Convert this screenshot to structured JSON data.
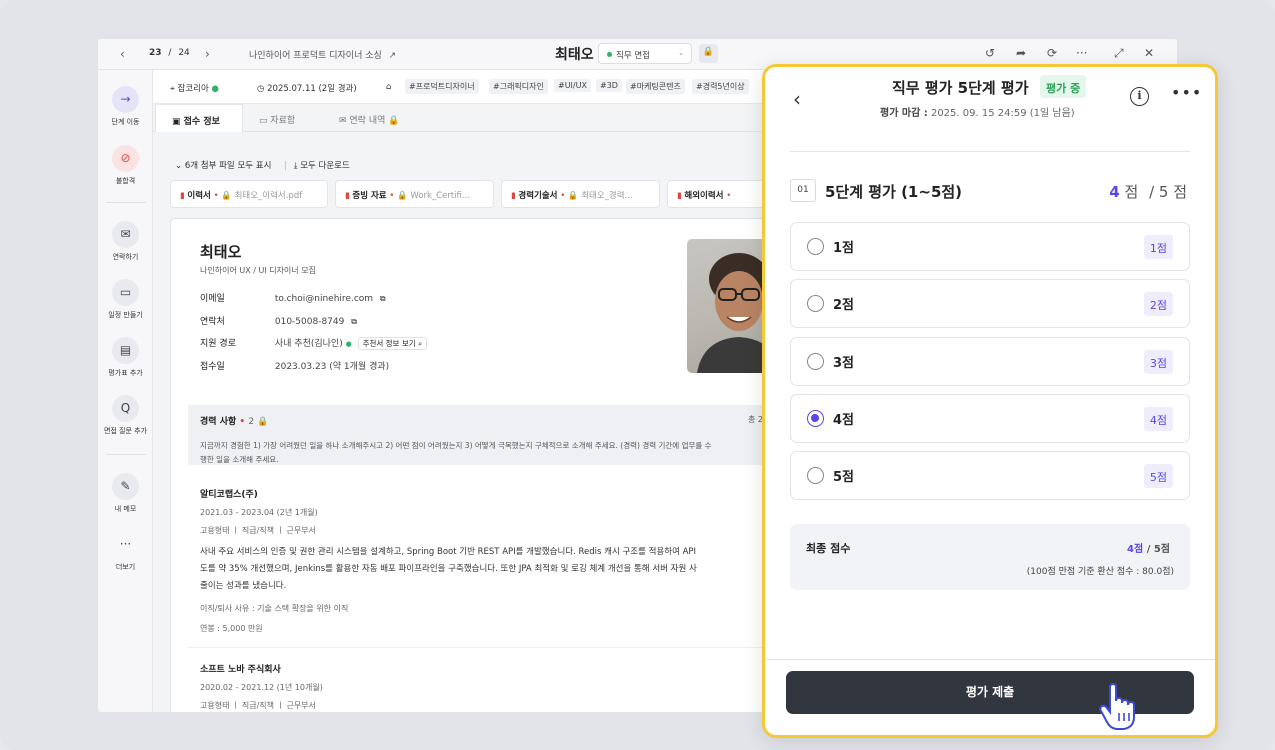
{
  "topbar": {
    "prev_icon": "chevron-left-icon",
    "next_icon": "chevron-right-icon",
    "page_current": "23",
    "page_sep": "/",
    "page_total": "24",
    "breadcrumb": "나인하이어 프로덕트 디자이너 소싱",
    "candidate_name": "최태오",
    "stage": "직무 면접",
    "stage_color": "#2fb36b"
  },
  "leftnav": {
    "items": [
      {
        "label": "단계 이동",
        "icon": "arrow-right-icon"
      },
      {
        "label": "불합격",
        "icon": "block-icon"
      },
      {
        "label": "연락하기",
        "icon": "mail-icon"
      },
      {
        "label": "일정 만들기",
        "icon": "calendar-icon"
      },
      {
        "label": "평가표 추가",
        "icon": "clipboard-icon"
      },
      {
        "label": "면접 질문 추가",
        "icon": "question-icon"
      },
      {
        "label": "내 메모",
        "icon": "edit-icon"
      },
      {
        "label": "더보기",
        "icon": "more-icon"
      }
    ]
  },
  "meta": {
    "source": "잡코리아",
    "date": "2025.07.11 (2일 경과)",
    "tags": [
      "#프로덕트디자이너",
      "#그래픽디자인",
      "#UI/UX",
      "#3D",
      "#마케팅콘텐츠",
      "#경력5년이상"
    ]
  },
  "tabs": [
    {
      "label": "접수 정보"
    },
    {
      "label": "자료함"
    },
    {
      "label": "연락 내역"
    }
  ],
  "files": {
    "toggle": "6개 첨부 파일 모두 표시",
    "download_all": "모두 다운로드",
    "items": [
      {
        "type": "이력서",
        "name": "최태오_이력서.pdf"
      },
      {
        "type": "증빙 자료",
        "name": "Work_Certifi..."
      },
      {
        "type": "경력기술서",
        "name": "최태오_경력..."
      },
      {
        "type": "해외이력서",
        "name": ""
      }
    ]
  },
  "profile": {
    "name": "최태오",
    "subtitle": "나인하이어 UX / UI 디자이너 모집",
    "email_label": "이메일",
    "email": "to.choi@ninehire.com",
    "phone_label": "연락처",
    "phone": "010-5008-8749",
    "route_label": "지원 경로",
    "route": "사내 추천(김나인)",
    "route_button": "추천서 정보 보기",
    "applied_label": "접수일",
    "applied": "2023.03.23 (약 1개월 경과)"
  },
  "experience": {
    "title": "경력 사항",
    "count": "2",
    "total_prefix": "총 2",
    "question": "지금까지 경험한 1) 가장 어려웠던 일을 하나 소개해주시고 2) 어떤 점이 어려웠는지 3) 어떻게 극복했는지 구체적으로 소개해 주세요. (경력) 경력 기간에 업무를 수",
    "question2": "행한 일을 소개해 주세요.",
    "jobs": [
      {
        "company": "알티코랩스(주)",
        "period": "2021.03 - 2023.04 (2년 1개월)",
        "fields": "고용형태  ㅣ 직급/직책  ㅣ 근무부서",
        "desc1": "사내 주요 서비스의 인증 및 권한 관리 시스템을 설계하고, Spring Boot 기반 REST API를 개발했습니다. Redis 캐시 구조를 적용하여 API",
        "desc2": "도를 약 35% 개선했으며, Jenkins를 활용한 자동 배포 파이프라인을 구축했습니다. 또한 JPA 최적화 및 로깅 체계 개선을 통해 서버 자원 사",
        "desc3": "줄이는 성과를 냈습니다.",
        "reason": "이직/퇴사 사유 : 기술 스택 확장을 위한 이직",
        "salary": "연봉 : 5,000 만원"
      },
      {
        "company": "소프트 노바 주식회사",
        "period": "2020.02 - 2021.12 (1년 10개월)",
        "fields": "고용형태  ㅣ 직급/직책  ㅣ 근무부서"
      }
    ]
  },
  "panel": {
    "title": "직무 평가 5단계 평가",
    "badge": "평가 중",
    "deadline_label": "평가 마감 :",
    "deadline": "2025. 09. 15 24:59 (1일 남음)",
    "question_num": "01",
    "question_title": "5단계 평가 (1~5점)",
    "score_value": "4",
    "score_unit": "점",
    "score_max": "/ 5 점",
    "options": [
      {
        "label": "1점",
        "tag": "1점",
        "selected": false
      },
      {
        "label": "2점",
        "tag": "2점",
        "selected": false
      },
      {
        "label": "3점",
        "tag": "3점",
        "selected": false
      },
      {
        "label": "4점",
        "tag": "4점",
        "selected": true
      },
      {
        "label": "5점",
        "tag": "5점",
        "selected": false
      }
    ],
    "final_label": "최종 점수",
    "final_score": "4점",
    "final_max": " / 5점",
    "final_note": "(100점 만점 기준 환산 점수 : 80.0점)",
    "submit": "평가 제출",
    "accent": "#5747e6",
    "highlight_border": "#f5c83a"
  }
}
